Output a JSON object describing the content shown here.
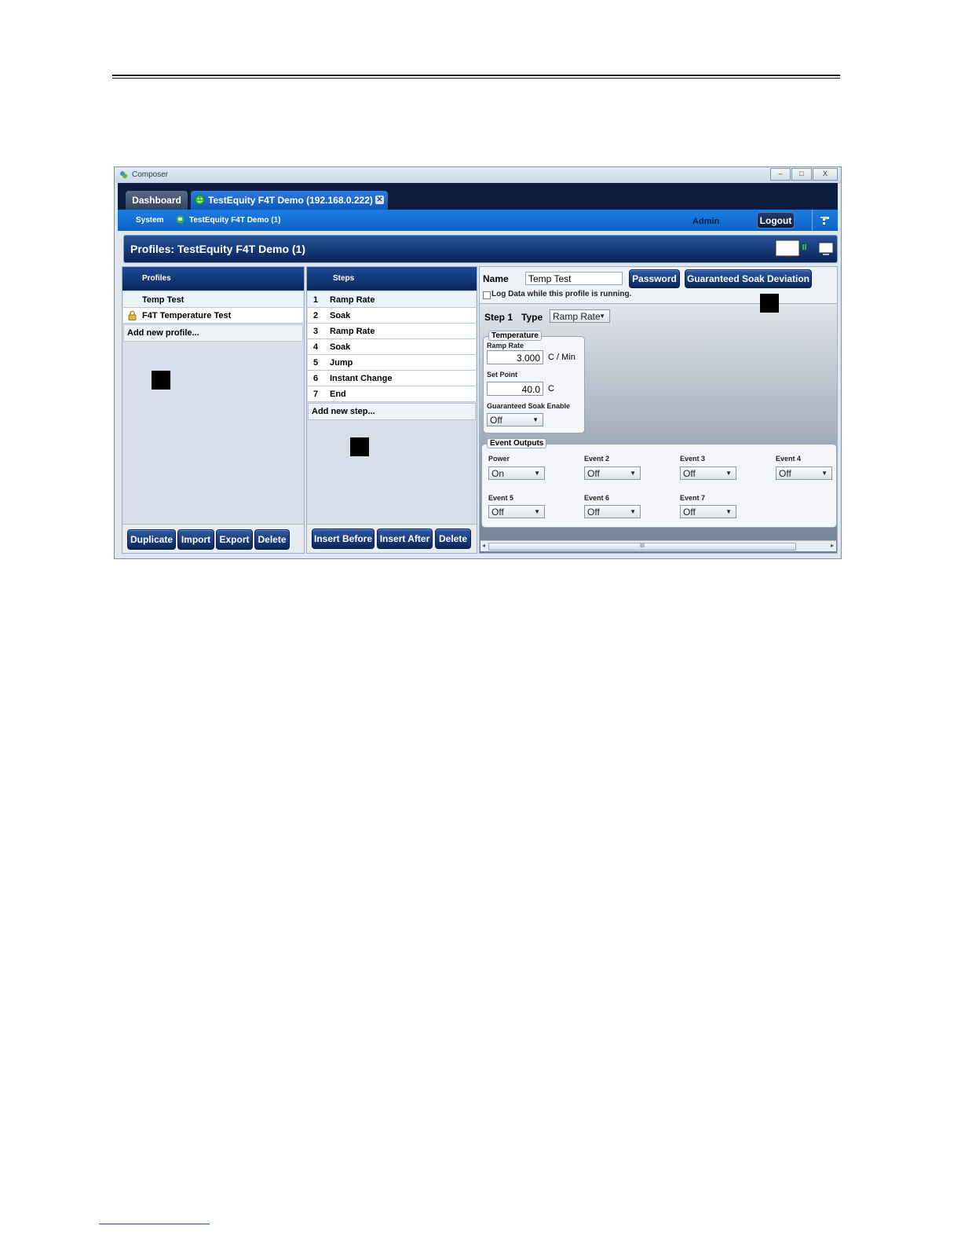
{
  "window": {
    "title": "Composer",
    "controls": {
      "minimize": "–",
      "maximize": "□",
      "close": "X"
    }
  },
  "tabs": [
    {
      "label": "Dashboard"
    },
    {
      "label": "TestEquity F4T Demo (192.168.0.222)",
      "close": "✕"
    }
  ],
  "nav": {
    "system": "System",
    "device": "TestEquity F4T Demo (1)",
    "user": "Admin",
    "logout": "Logout"
  },
  "header": {
    "title": "Profiles: TestEquity F4T Demo (1)"
  },
  "profiles": {
    "heading": "Profiles",
    "items": [
      {
        "label": "Temp Test",
        "locked": false
      },
      {
        "label": "F4T Temperature Test",
        "locked": true
      }
    ],
    "add_new": "Add new profile...",
    "buttons": {
      "duplicate": "Duplicate",
      "import": "Import",
      "export": "Export",
      "delete": "Delete"
    }
  },
  "steps": {
    "heading": "Steps",
    "items": [
      {
        "num": "1",
        "label": "Ramp Rate"
      },
      {
        "num": "2",
        "label": "Soak"
      },
      {
        "num": "3",
        "label": "Ramp Rate"
      },
      {
        "num": "4",
        "label": "Soak"
      },
      {
        "num": "5",
        "label": "Jump"
      },
      {
        "num": "6",
        "label": "Instant Change"
      },
      {
        "num": "7",
        "label": "End"
      }
    ],
    "add_new": "Add new step...",
    "buttons": {
      "insert_before": "Insert Before",
      "insert_after": "Insert After",
      "delete": "Delete"
    }
  },
  "editor": {
    "name_label": "Name",
    "name_value": "Temp Test",
    "password_button": "Password",
    "gsd_button": "Guaranteed Soak Deviation",
    "log_label": "Log Data while this profile is running.",
    "log_checked": false,
    "step_label": "Step 1",
    "type_label": "Type",
    "type_value": "Ramp Rate",
    "temperature": {
      "title": "Temperature",
      "ramp_rate_label": "Ramp Rate",
      "ramp_rate_value": "3.000",
      "ramp_rate_unit": "C / Min",
      "set_point_label": "Set Point",
      "set_point_value": "40.0",
      "set_point_unit": "C",
      "gse_label": "Guaranteed Soak Enable",
      "gse_value": "Off"
    },
    "events": {
      "title": "Event Outputs",
      "items": [
        {
          "label": "Power",
          "value": "On"
        },
        {
          "label": "Event 2",
          "value": "Off"
        },
        {
          "label": "Event 3",
          "value": "Off"
        },
        {
          "label": "Event 4",
          "value": "Off"
        },
        {
          "label": "Event 5",
          "value": "Off"
        },
        {
          "label": "Event 6",
          "value": "Off"
        },
        {
          "label": "Event 7",
          "value": "Off"
        }
      ]
    },
    "scroll_grip": "III"
  },
  "colors": {
    "tabbar": "#0d1d3d",
    "navbar": "#1272d6",
    "header": "#0a2457",
    "button": "#0a2559",
    "status_ok": "#2dbb3a"
  }
}
